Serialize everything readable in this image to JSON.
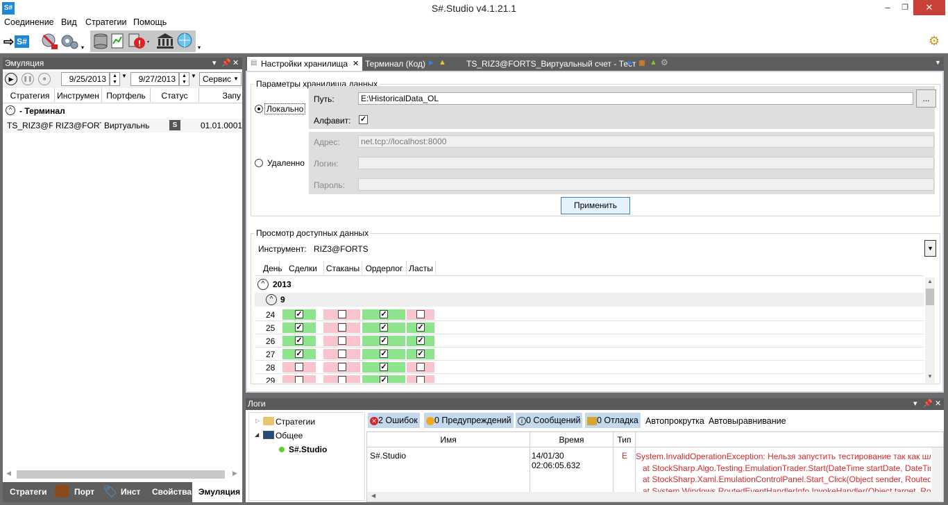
{
  "window": {
    "title": "S#.Studio v4.1.21.1",
    "icon_text": "S#",
    "min": "–",
    "max": "❐",
    "close": "✕"
  },
  "menu": [
    "Соединение",
    "Вид",
    "Стратегии",
    "Помощь"
  ],
  "toolbar": {
    "connect_text": "S#"
  },
  "left_panel": {
    "title": "Эмуляция",
    "date_from": "9/25/2013",
    "date_to": "9/27/2013",
    "service": "Сервис",
    "columns": [
      "Стратегия",
      "Инструмен",
      "Портфель",
      "Статус",
      "Запу"
    ],
    "group": "- Терминал",
    "row": {
      "strategy": "TS_RIZ3@FC",
      "instrument": "RIZ3@FORT",
      "portfolio": "Виртуальнь",
      "status_icon": "S",
      "start": "01.01.0001"
    },
    "bottom_tabs": [
      "Стратеги",
      "Порт",
      "Инст",
      "Свойства",
      "Эмуляция"
    ]
  },
  "right_tabs": [
    {
      "label": "Настройки хранилища",
      "close": "✕"
    },
    {
      "label": "Терминал (Код)"
    },
    {
      "label": "TS_RIZ3@FORTS_Виртуальный счет - Тест"
    }
  ],
  "storage": {
    "group1_title": "Параметры хранилища данных",
    "local_label": "Локально",
    "remote_label": "Удаленно",
    "path_label": "Путь:",
    "path_value": "E:\\HistoricalData_OL",
    "browse": "...",
    "alphabet_label": "Алфавит:",
    "address_label": "Адрес:",
    "address_value": "net.tcp://localhost:8000",
    "login_label": "Логин:",
    "password_label": "Пароль:",
    "apply": "Применить",
    "group2_title": "Просмотр доступных данных",
    "instrument_label": "Инструмент:",
    "instrument_value": "RIZ3@FORTS",
    "grid_columns": [
      "День",
      "Сделки",
      "Стаканы",
      "Ордерлог",
      "Ласты"
    ],
    "year": "2013",
    "month": "9",
    "days": [
      {
        "day": "24",
        "trades": true,
        "depth": false,
        "orderlog": true,
        "last": false,
        "trades_ok": true,
        "depth_ok": false,
        "orderlog_ok": true,
        "last_ok": false
      },
      {
        "day": "25",
        "trades": true,
        "depth": false,
        "orderlog": true,
        "last": true,
        "trades_ok": true,
        "depth_ok": false,
        "orderlog_ok": true,
        "last_ok": true
      },
      {
        "day": "26",
        "trades": true,
        "depth": false,
        "orderlog": true,
        "last": true,
        "trades_ok": true,
        "depth_ok": false,
        "orderlog_ok": true,
        "last_ok": true
      },
      {
        "day": "27",
        "trades": true,
        "depth": false,
        "orderlog": true,
        "last": true,
        "trades_ok": true,
        "depth_ok": false,
        "orderlog_ok": true,
        "last_ok": true
      },
      {
        "day": "28",
        "trades": false,
        "depth": false,
        "orderlog": true,
        "last": false,
        "trades_ok": false,
        "depth_ok": false,
        "orderlog_ok": true,
        "last_ok": false
      },
      {
        "day": "29",
        "trades": false,
        "depth": false,
        "orderlog": true,
        "last": false,
        "trades_ok": false,
        "depth_ok": false,
        "orderlog_ok": true,
        "last_ok": false
      }
    ]
  },
  "logs": {
    "title": "Логи",
    "tree": [
      "Стратегии",
      "Общее",
      "S#.Studio"
    ],
    "filters": {
      "errors": "2 Ошибок",
      "warnings": "0 Предупреждений",
      "messages": "0 Сообщений",
      "debug": "0 Отладка"
    },
    "autoscroll": "Автопрокрутка",
    "autoalign": "Автовыравнивание",
    "columns": [
      "Имя",
      "Время",
      "Тип"
    ],
    "entry": {
      "name": "S#.Studio",
      "time": "14/01/30 02:06:05.632",
      "type": "E",
      "lines": [
        "System.InvalidOperationException: Нельзя запустить тестирование так как шлю",
        "at StockSharp.Algo.Testing.EmulationTrader.Start(DateTime startDate, DateTime",
        "at StockSharp.Xaml.EmulationControlPanel.Start_Click(Object sender, RoutedEve",
        "at System.Windows.RoutedEventHandlerInfo.InvokeHandler(Object target, Rout"
      ]
    }
  },
  "colors": {
    "ok": "#8de48d",
    "missing": "#f9c4cc",
    "panel_header": "#5a5a5a",
    "error": "#d12a2a",
    "close": "#c7403a"
  }
}
